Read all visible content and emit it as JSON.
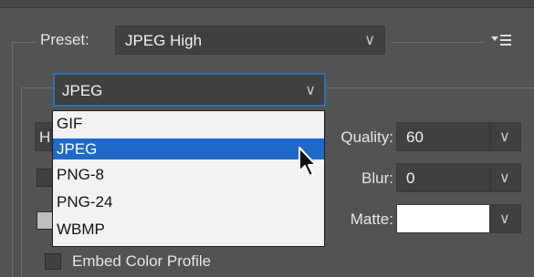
{
  "preset": {
    "label": "Preset:",
    "value": "JPEG High"
  },
  "format": {
    "value": "JPEG",
    "options": [
      "GIF",
      "JPEG",
      "PNG-8",
      "PNG-24",
      "WBMP"
    ],
    "selected_index": 1
  },
  "partial": {
    "left_letter": "H"
  },
  "quality": {
    "label": "Quality:",
    "value": "60"
  },
  "blur": {
    "label": "Blur:",
    "value": "0"
  },
  "matte": {
    "label": "Matte:",
    "color": "#ffffff"
  },
  "embed_profile": {
    "label": "Embed Color Profile",
    "checked": false
  },
  "colors": {
    "panel": "#535353",
    "field": "#404040",
    "accent": "#1f69c9",
    "focus": "#2f6eb4"
  },
  "icons": [
    "chevron-down-icon",
    "panel-menu-icon",
    "mouse-pointer-icon"
  ]
}
